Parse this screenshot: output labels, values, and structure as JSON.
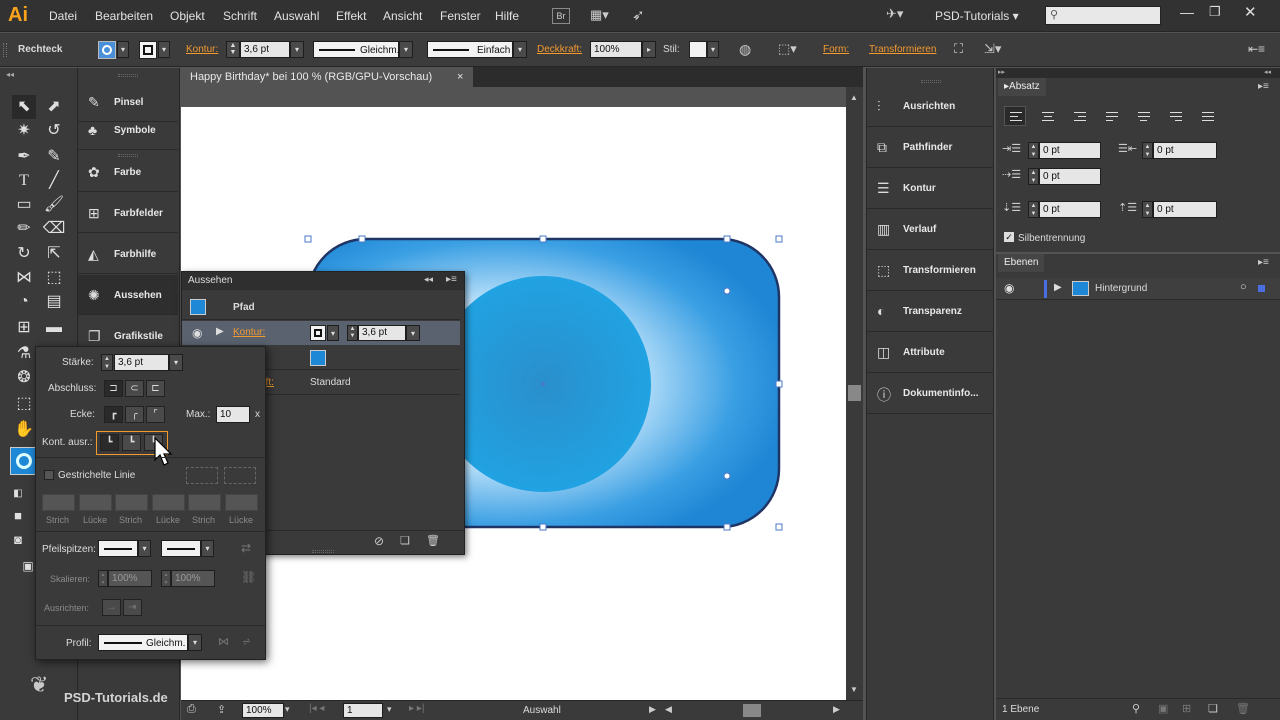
{
  "app": {
    "logo": "Ai",
    "workspace": "PSD-Tutorials",
    "br_label": "Br"
  },
  "menu": [
    "Datei",
    "Bearbeiten",
    "Objekt",
    "Schrift",
    "Auswahl",
    "Effekt",
    "Ansicht",
    "Fenster",
    "Hilfe"
  ],
  "control": {
    "tool_name": "Rechteck",
    "kontur_label": "Kontur:",
    "stroke_weight": "3,6 pt",
    "profile": "Gleichm.",
    "brush": "Einfach",
    "opacity_label": "Deckkraft:",
    "opacity": "100%",
    "style_label": "Stil:",
    "form_label": "Form:",
    "transform_label": "Transformieren"
  },
  "document": {
    "tab_title": "Happy Birthday* bei 100 % (RGB/GPU-Vorschau)",
    "close": "×"
  },
  "left_panels": [
    "Pinsel",
    "Symbole",
    "Farbe",
    "Farbfelder",
    "Farbhilfe",
    "Aussehen",
    "Grafikstile"
  ],
  "right_panels": [
    "Ausrichten",
    "Pathfinder",
    "Kontur",
    "Verlauf",
    "Transformieren",
    "Transparenz",
    "Attribute",
    "Dokumentinfo..."
  ],
  "absatz": {
    "tab": "Absatz",
    "fields": [
      "0 pt",
      "0 pt",
      "0 pt",
      "0 pt",
      "0 pt"
    ],
    "hyphenation": "Silbentrennung"
  },
  "ebenen": {
    "tab": "Ebenen",
    "layer_name": "Hintergrund",
    "count": "1 Ebene"
  },
  "aussehen": {
    "title": "Aussehen",
    "path_label": "Pfad",
    "kontur_label": "Kontur:",
    "kontur_value": "3,6 pt",
    "deckkraft_partial": "aft:",
    "deckkraft_value": "Standard"
  },
  "kontur_panel": {
    "staerke_label": "Stärke:",
    "staerke_value": "3,6 pt",
    "abschluss_label": "Abschluss:",
    "ecke_label": "Ecke:",
    "max_label": "Max.:",
    "max_value": "10",
    "max_unit": "x",
    "kont_ausr_label": "Kont. ausr.:",
    "dashed_label": "Gestrichelte Linie",
    "dash_labels": [
      "Strich",
      "Lücke",
      "Strich",
      "Lücke",
      "Strich",
      "Lücke"
    ],
    "pfeilspitzen_label": "Pfeilspitzen:",
    "skalieren_label": "Skalieren:",
    "scale_1": "100%",
    "scale_2": "100%",
    "ausrichten_label": "Ausrichten:",
    "profil_label": "Profil:",
    "profil_value": "Gleichm."
  },
  "status": {
    "zoom": "100%",
    "page": "1",
    "tool": "Auswahl"
  },
  "watermark": "PSD-Tutorials.de",
  "colors": {
    "accent_orange": "#f29a2e",
    "shape_blue": "#1e88d6",
    "highlight_blue": "#1a9bd7"
  }
}
